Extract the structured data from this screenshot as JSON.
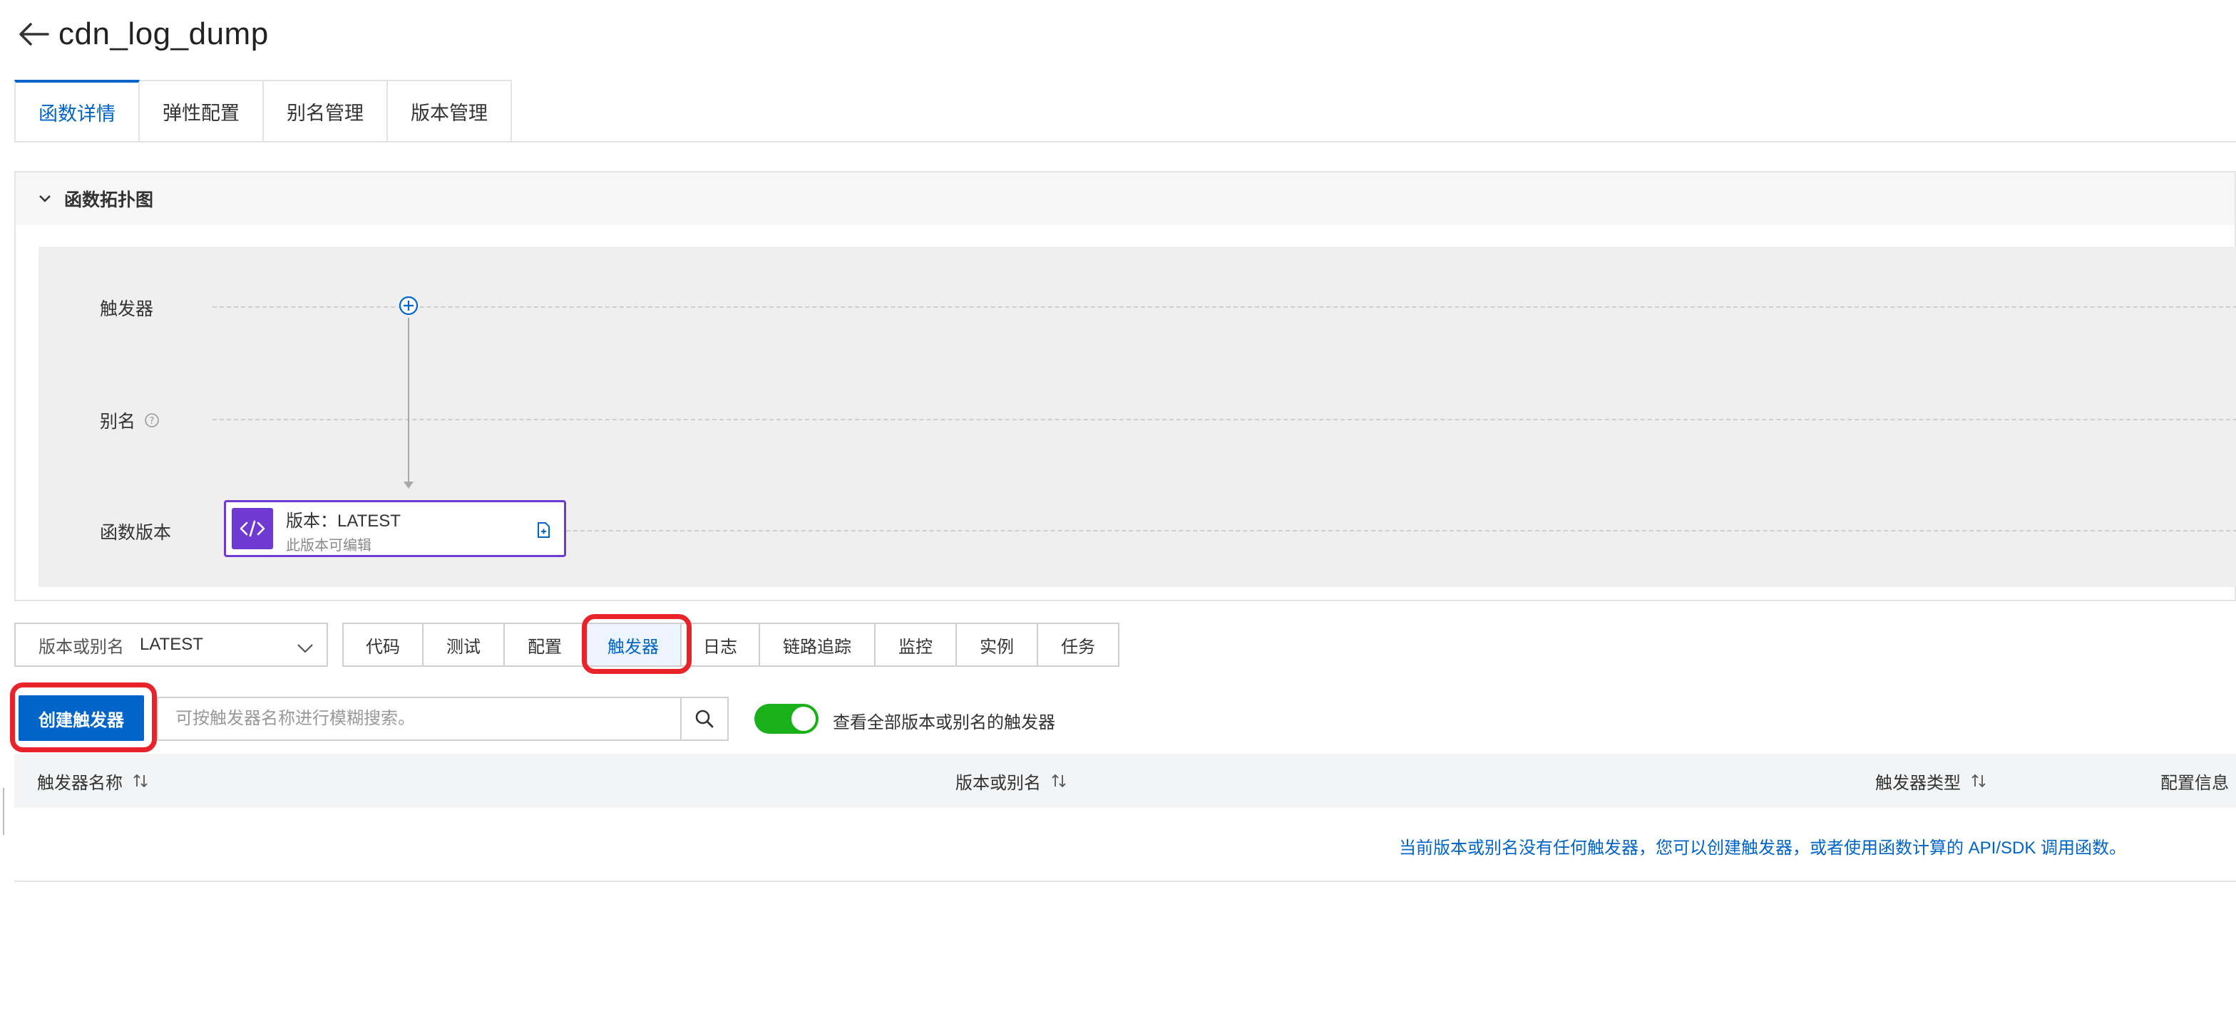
{
  "header": {
    "title": "cdn_log_dump"
  },
  "main_tabs": [
    {
      "label": "函数详情",
      "active": true
    },
    {
      "label": "弹性配置",
      "active": false
    },
    {
      "label": "别名管理",
      "active": false
    },
    {
      "label": "版本管理",
      "active": false
    }
  ],
  "topology": {
    "title": "函数拓扑图",
    "rows": {
      "trigger": "触发器",
      "alias": "别名",
      "version": "函数版本"
    },
    "version_card": {
      "title": "版本：LATEST",
      "subtitle": "此版本可编辑"
    }
  },
  "version_selector": {
    "label": "版本或别名",
    "value": "LATEST"
  },
  "sub_tabs": [
    {
      "label": "代码",
      "active": false
    },
    {
      "label": "测试",
      "active": false
    },
    {
      "label": "配置",
      "active": false
    },
    {
      "label": "触发器",
      "active": true
    },
    {
      "label": "日志",
      "active": false
    },
    {
      "label": "链路追踪",
      "active": false
    },
    {
      "label": "监控",
      "active": false
    },
    {
      "label": "实例",
      "active": false
    },
    {
      "label": "任务",
      "active": false
    }
  ],
  "trigger_toolbar": {
    "create_label": "创建触发器",
    "search_placeholder": "可按触发器名称进行模糊搜索。",
    "toggle_on": true,
    "toggle_label": "查看全部版本或别名的触发器"
  },
  "table": {
    "columns": [
      "触发器名称",
      "版本或别名",
      "触发器类型",
      "配置信息"
    ],
    "empty_message": "当前版本或别名没有任何触发器，您可以创建触发器，或者使用函数计算的 API/SDK 调用函数。"
  },
  "colors": {
    "primary": "#0064c8",
    "highlight": "#e8242a",
    "toggle_on": "#1ab01a",
    "version_card": "#6f3ad1"
  }
}
